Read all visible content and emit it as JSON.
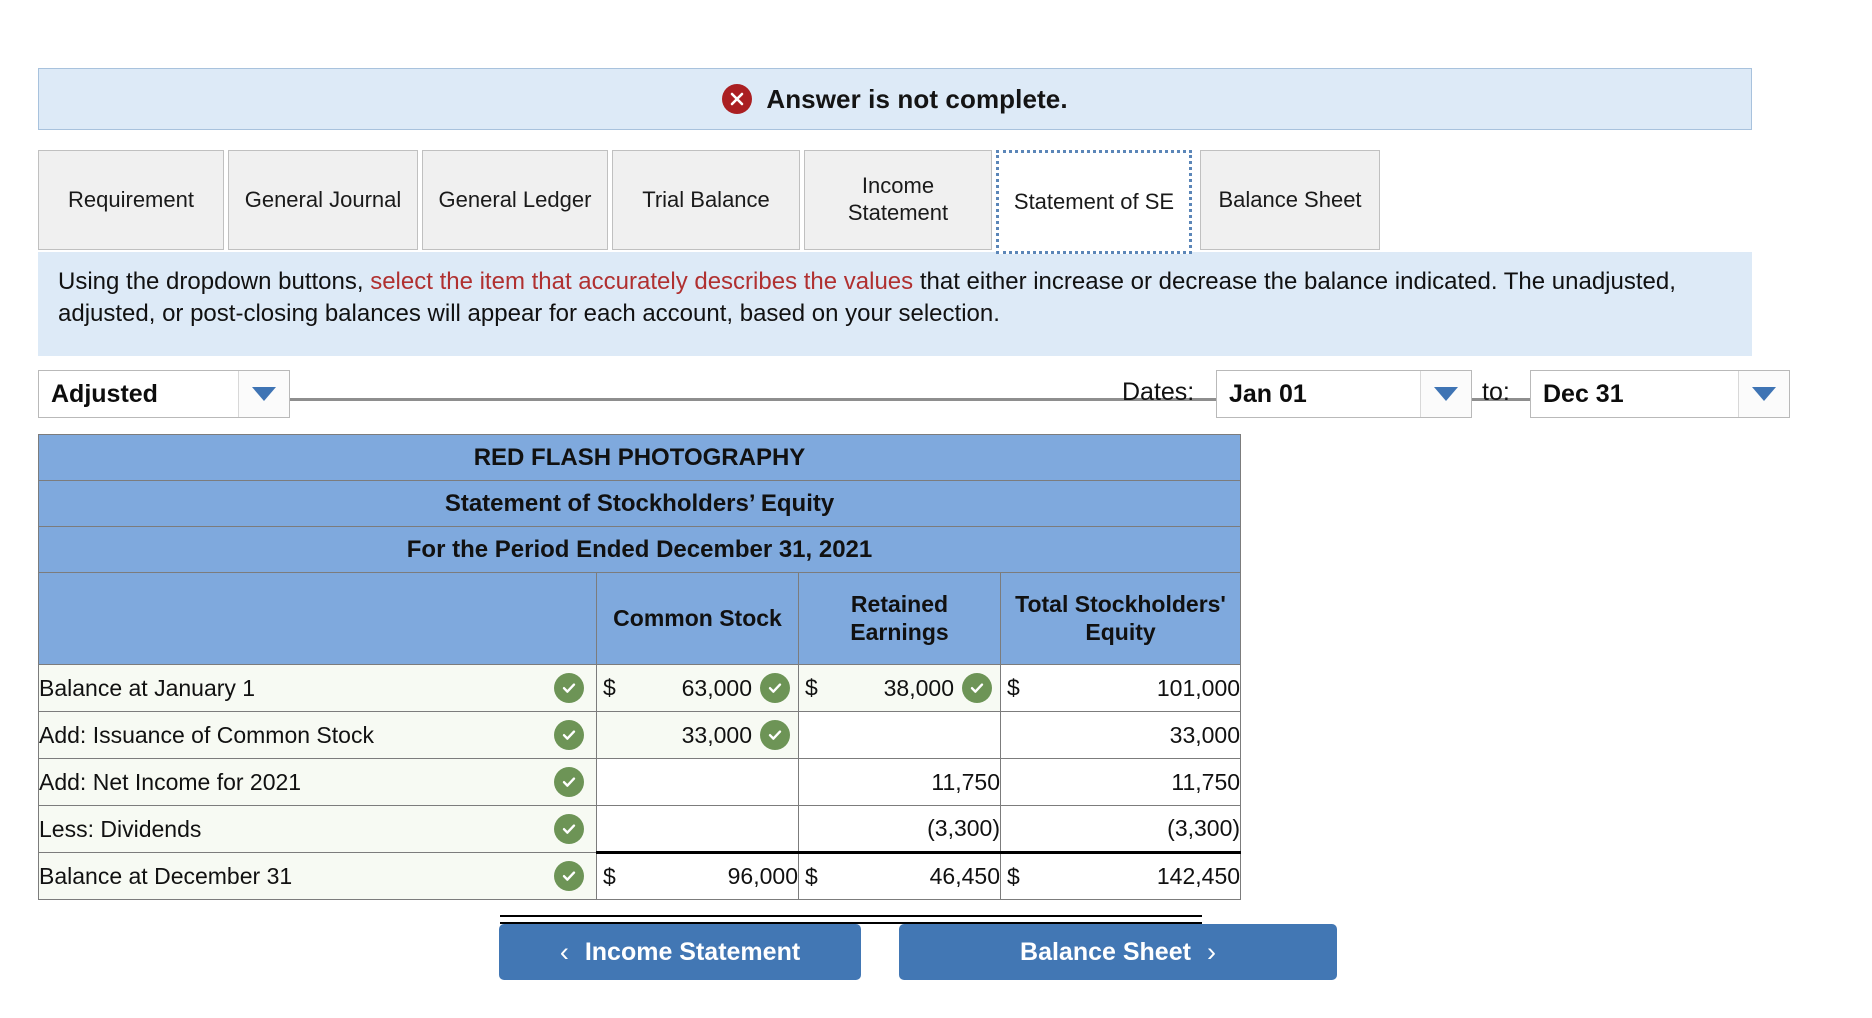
{
  "alert": {
    "icon": "error-x-icon",
    "message": "Answer is not complete."
  },
  "tabs": [
    {
      "label": "Requirement",
      "active": false
    },
    {
      "label": "General Journal",
      "active": false
    },
    {
      "label": "General Ledger",
      "active": false
    },
    {
      "label": "Trial Balance",
      "active": false
    },
    {
      "label": "Income Statement",
      "active": false
    },
    {
      "label": "Statement of SE",
      "active": true
    },
    {
      "label": "Balance Sheet",
      "active": false
    }
  ],
  "instruction": {
    "part1": "Using the dropdown buttons, ",
    "highlight": "select the item that accurately describes the values",
    "part2": " that either increase or decrease the  balance indicated. The unadjusted, adjusted, or post-closing balances will appear for each account, based on your selection."
  },
  "controls": {
    "basis_value": "Adjusted",
    "dates_label": "Dates:",
    "date_from": "Jan 01",
    "to_label": "to:",
    "date_to": "Dec 31"
  },
  "statement": {
    "company": "RED FLASH PHOTOGRAPHY",
    "title": "Statement of Stockholders’ Equity",
    "period": "For the Period Ended December 31, 2021",
    "columns": [
      {
        "label": ""
      },
      {
        "label": "Common Stock"
      },
      {
        "label": "Retained Earnings"
      },
      {
        "label": "Total Stockholders' Equity"
      }
    ],
    "rows": [
      {
        "label": "Balance at January 1",
        "label_checked": true,
        "common_stock": {
          "dollar": "$",
          "value": "63,000",
          "checked": true
        },
        "retained_earnings": {
          "dollar": "$",
          "value": "38,000",
          "checked": true
        },
        "total": {
          "dollar": "$",
          "value": "101,000",
          "checked": false
        }
      },
      {
        "label": "Add: Issuance of Common Stock",
        "label_checked": true,
        "common_stock": {
          "dollar": "",
          "value": "33,000",
          "checked": true
        },
        "retained_earnings": {
          "dollar": "",
          "value": "",
          "checked": false
        },
        "total": {
          "dollar": "",
          "value": "33,000",
          "checked": false
        }
      },
      {
        "label": "Add: Net Income for 2021",
        "label_checked": true,
        "common_stock": {
          "dollar": "",
          "value": "",
          "checked": false
        },
        "retained_earnings": {
          "dollar": "",
          "value": "11,750",
          "checked": false
        },
        "total": {
          "dollar": "",
          "value": "11,750",
          "checked": false
        }
      },
      {
        "label": "Less: Dividends",
        "label_checked": true,
        "common_stock": {
          "dollar": "",
          "value": "",
          "checked": false
        },
        "retained_earnings": {
          "dollar": "",
          "value": "(3,300)",
          "checked": false
        },
        "total": {
          "dollar": "",
          "value": "(3,300)",
          "checked": false
        }
      },
      {
        "label": "Balance at December 31",
        "label_checked": true,
        "total_row": true,
        "common_stock": {
          "dollar": "$",
          "value": "96,000",
          "checked": false
        },
        "retained_earnings": {
          "dollar": "$",
          "value": "46,450",
          "checked": false
        },
        "total": {
          "dollar": "$",
          "value": "142,450",
          "checked": false
        }
      }
    ]
  },
  "footer": {
    "prev_label": "Income Statement",
    "prev_chevron": "‹",
    "next_label": "Balance Sheet",
    "next_chevron": "›"
  },
  "colors": {
    "banner_bg": "#ddeaf7",
    "error_red": "#aa1f22",
    "highlight_red": "#b03030",
    "table_header_blue": "#7fa9dd",
    "checked_green": "#6d9456",
    "button_blue": "#4277b4",
    "active_tab_border": "#5b86b8"
  }
}
